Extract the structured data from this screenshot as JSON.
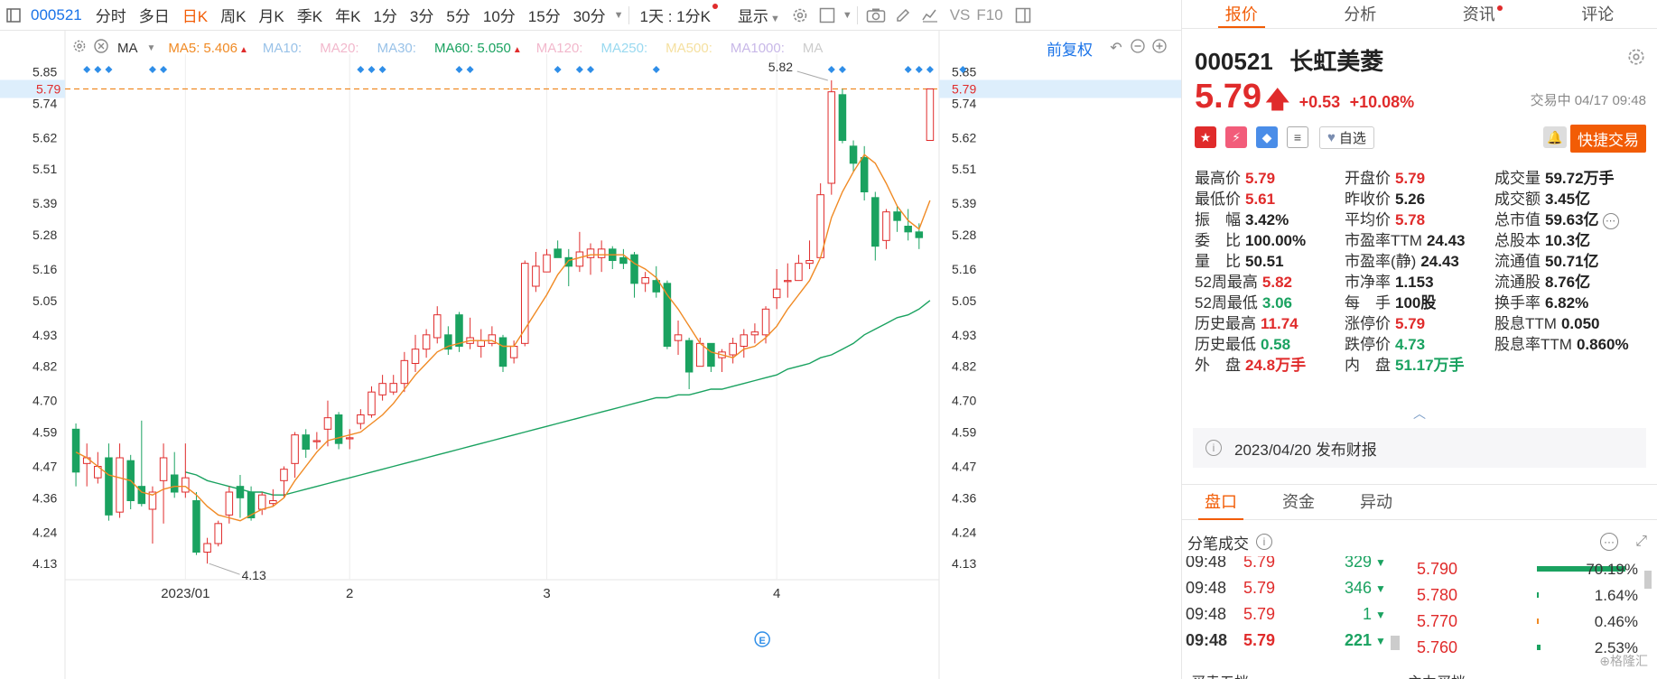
{
  "toolbar": {
    "code": "000521",
    "periods": [
      "分时",
      "多日",
      "日K",
      "周K",
      "月K",
      "季K",
      "年K",
      "1分",
      "3分",
      "5分",
      "10分",
      "15分",
      "30分"
    ],
    "active_period": "日K",
    "range_select": "1天 : 1分K",
    "display_label": "显示",
    "vs_label": "VS",
    "f10_label": "F10"
  },
  "ma_bar": {
    "type_label": "MA",
    "items": [
      {
        "label": "MA5:",
        "value": "5.406",
        "color": "#f08a24",
        "show_value": true
      },
      {
        "label": "MA10:",
        "value": "",
        "color": "#99c2e8",
        "show_value": false
      },
      {
        "label": "MA20:",
        "value": "",
        "color": "#f2b8cc",
        "show_value": false
      },
      {
        "label": "MA30:",
        "value": "",
        "color": "#99c2e8",
        "show_value": false
      },
      {
        "label": "MA60:",
        "value": "5.050",
        "color": "#1aa260",
        "show_value": true
      },
      {
        "label": "MA120:",
        "value": "",
        "color": "#f2b8cc",
        "show_value": false
      },
      {
        "label": "MA250:",
        "value": "",
        "color": "#99d9f0",
        "show_value": false
      },
      {
        "label": "MA500:",
        "value": "",
        "color": "#f5e0a0",
        "show_value": false
      },
      {
        "label": "MA1000:",
        "value": "",
        "color": "#c8b8e8",
        "show_value": false
      },
      {
        "label": "MA",
        "value": "",
        "color": "#cccccc",
        "show_value": false
      }
    ],
    "adjust_label": "前复权"
  },
  "chart_data": {
    "type": "candlestick",
    "price_axis_ticks": [
      "5.85",
      "5.74",
      "5.62",
      "5.51",
      "5.39",
      "5.28",
      "5.16",
      "5.05",
      "4.93",
      "4.82",
      "4.70",
      "4.59",
      "4.47",
      "4.36",
      "4.24",
      "4.13"
    ],
    "ylim": [
      4.08,
      5.88
    ],
    "current_price_label": "5.79",
    "current_price": 5.79,
    "x_ticks": [
      {
        "label": "2023/01",
        "index": 10
      },
      {
        "label": "2",
        "index": 25
      },
      {
        "label": "3",
        "index": 43
      },
      {
        "label": "4",
        "index": 64
      }
    ],
    "high_annotation": "5.82",
    "low_annotation": "4.13",
    "candles": [
      {
        "o": 4.6,
        "c": 4.45,
        "h": 4.62,
        "l": 4.4
      },
      {
        "o": 4.48,
        "c": 4.5,
        "h": 4.55,
        "l": 4.4
      },
      {
        "o": 4.43,
        "c": 4.47,
        "h": 4.52,
        "l": 4.41
      },
      {
        "o": 4.5,
        "c": 4.3,
        "h": 4.55,
        "l": 4.28
      },
      {
        "o": 4.31,
        "c": 4.5,
        "h": 4.55,
        "l": 4.29
      },
      {
        "o": 4.49,
        "c": 4.35,
        "h": 4.51,
        "l": 4.32
      },
      {
        "o": 4.4,
        "c": 4.34,
        "h": 4.63,
        "l": 4.33
      },
      {
        "o": 4.32,
        "c": 4.38,
        "h": 4.4,
        "l": 4.2
      },
      {
        "o": 4.42,
        "c": 4.5,
        "h": 4.55,
        "l": 4.27
      },
      {
        "o": 4.44,
        "c": 4.38,
        "h": 4.52,
        "l": 4.36
      },
      {
        "o": 4.38,
        "c": 4.43,
        "h": 4.55,
        "l": 4.36
      },
      {
        "o": 4.35,
        "c": 4.17,
        "h": 4.38,
        "l": 4.16
      },
      {
        "o": 4.17,
        "c": 4.2,
        "h": 4.22,
        "l": 4.13
      },
      {
        "o": 4.2,
        "c": 4.27,
        "h": 4.28,
        "l": 4.19
      },
      {
        "o": 4.3,
        "c": 4.38,
        "h": 4.4,
        "l": 4.27
      },
      {
        "o": 4.4,
        "c": 4.36,
        "h": 4.44,
        "l": 4.29
      },
      {
        "o": 4.38,
        "c": 4.29,
        "h": 4.4,
        "l": 4.28
      },
      {
        "o": 4.32,
        "c": 4.37,
        "h": 4.38,
        "l": 4.3
      },
      {
        "o": 4.34,
        "c": 4.35,
        "h": 4.39,
        "l": 4.33
      },
      {
        "o": 4.42,
        "c": 4.46,
        "h": 4.47,
        "l": 4.36
      },
      {
        "o": 4.48,
        "c": 4.58,
        "h": 4.59,
        "l": 4.43
      },
      {
        "o": 4.58,
        "c": 4.53,
        "h": 4.6,
        "l": 4.5
      },
      {
        "o": 4.56,
        "c": 4.56,
        "h": 4.59,
        "l": 4.53
      },
      {
        "o": 4.6,
        "c": 4.64,
        "h": 4.7,
        "l": 4.54
      },
      {
        "o": 4.65,
        "c": 4.55,
        "h": 4.66,
        "l": 4.53
      },
      {
        "o": 4.57,
        "c": 4.57,
        "h": 4.6,
        "l": 4.53
      },
      {
        "o": 4.62,
        "c": 4.65,
        "h": 4.67,
        "l": 4.6
      },
      {
        "o": 4.65,
        "c": 4.73,
        "h": 4.75,
        "l": 4.64
      },
      {
        "o": 4.72,
        "c": 4.76,
        "h": 4.79,
        "l": 4.7
      },
      {
        "o": 4.73,
        "c": 4.76,
        "h": 4.79,
        "l": 4.72
      },
      {
        "o": 4.76,
        "c": 4.84,
        "h": 4.87,
        "l": 4.73
      },
      {
        "o": 4.83,
        "c": 4.88,
        "h": 4.93,
        "l": 4.8
      },
      {
        "o": 4.88,
        "c": 4.93,
        "h": 4.95,
        "l": 4.85
      },
      {
        "o": 4.92,
        "c": 5.0,
        "h": 5.03,
        "l": 4.9
      },
      {
        "o": 4.93,
        "c": 4.88,
        "h": 4.96,
        "l": 4.86
      },
      {
        "o": 5.0,
        "c": 4.89,
        "h": 5.01,
        "l": 4.87
      },
      {
        "o": 4.9,
        "c": 4.92,
        "h": 4.99,
        "l": 4.88
      },
      {
        "o": 4.89,
        "c": 4.91,
        "h": 4.95,
        "l": 4.85
      },
      {
        "o": 4.9,
        "c": 4.93,
        "h": 4.96,
        "l": 4.89
      },
      {
        "o": 4.92,
        "c": 4.82,
        "h": 4.93,
        "l": 4.8
      },
      {
        "o": 4.85,
        "c": 4.89,
        "h": 4.91,
        "l": 4.83
      },
      {
        "o": 4.9,
        "c": 5.18,
        "h": 5.19,
        "l": 4.89
      },
      {
        "o": 5.1,
        "c": 5.17,
        "h": 5.22,
        "l": 5.08
      },
      {
        "o": 5.15,
        "c": 5.21,
        "h": 5.23,
        "l": 5.15
      },
      {
        "o": 5.23,
        "c": 5.2,
        "h": 5.26,
        "l": 5.2
      },
      {
        "o": 5.2,
        "c": 5.17,
        "h": 5.23,
        "l": 5.1
      },
      {
        "o": 5.17,
        "c": 5.22,
        "h": 5.29,
        "l": 5.15
      },
      {
        "o": 5.2,
        "c": 5.23,
        "h": 5.25,
        "l": 5.14
      },
      {
        "o": 5.2,
        "c": 5.23,
        "h": 5.26,
        "l": 5.15
      },
      {
        "o": 5.23,
        "c": 5.19,
        "h": 5.24,
        "l": 5.16
      },
      {
        "o": 5.2,
        "c": 5.18,
        "h": 5.23,
        "l": 5.16
      },
      {
        "o": 5.21,
        "c": 5.11,
        "h": 5.22,
        "l": 5.06
      },
      {
        "o": 5.11,
        "c": 5.13,
        "h": 5.15,
        "l": 5.08
      },
      {
        "o": 5.12,
        "c": 5.08,
        "h": 5.17,
        "l": 5.06
      },
      {
        "o": 5.11,
        "c": 4.89,
        "h": 5.12,
        "l": 4.88
      },
      {
        "o": 4.91,
        "c": 4.93,
        "h": 4.98,
        "l": 4.86
      },
      {
        "o": 4.91,
        "c": 4.8,
        "h": 4.92,
        "l": 4.74
      },
      {
        "o": 4.82,
        "c": 4.9,
        "h": 4.92,
        "l": 4.82
      },
      {
        "o": 4.9,
        "c": 4.82,
        "h": 4.9,
        "l": 4.8
      },
      {
        "o": 4.85,
        "c": 4.87,
        "h": 4.88,
        "l": 4.8
      },
      {
        "o": 4.86,
        "c": 4.9,
        "h": 4.92,
        "l": 4.83
      },
      {
        "o": 4.89,
        "c": 4.93,
        "h": 4.95,
        "l": 4.85
      },
      {
        "o": 4.93,
        "c": 4.94,
        "h": 4.97,
        "l": 4.9
      },
      {
        "o": 4.93,
        "c": 5.02,
        "h": 5.03,
        "l": 4.9
      },
      {
        "o": 5.06,
        "c": 5.09,
        "h": 5.16,
        "l": 5.02
      },
      {
        "o": 5.12,
        "c": 5.12,
        "h": 5.18,
        "l": 5.06
      },
      {
        "o": 5.12,
        "c": 5.18,
        "h": 5.21,
        "l": 5.12
      },
      {
        "o": 5.18,
        "c": 5.19,
        "h": 5.26,
        "l": 5.16
      },
      {
        "o": 5.2,
        "c": 5.42,
        "h": 5.46,
        "l": 5.2
      },
      {
        "o": 5.46,
        "c": 5.78,
        "h": 5.82,
        "l": 5.42
      },
      {
        "o": 5.77,
        "c": 5.61,
        "h": 5.79,
        "l": 5.6
      },
      {
        "o": 5.59,
        "c": 5.53,
        "h": 5.61,
        "l": 5.5
      },
      {
        "o": 5.55,
        "c": 5.43,
        "h": 5.59,
        "l": 5.4
      },
      {
        "o": 5.41,
        "c": 5.24,
        "h": 5.43,
        "l": 5.19
      },
      {
        "o": 5.26,
        "c": 5.36,
        "h": 5.37,
        "l": 5.23
      },
      {
        "o": 5.36,
        "c": 5.33,
        "h": 5.38,
        "l": 5.29
      },
      {
        "o": 5.31,
        "c": 5.29,
        "h": 5.37,
        "l": 5.26
      },
      {
        "o": 5.29,
        "c": 5.27,
        "h": 5.32,
        "l": 5.23
      },
      {
        "o": 5.61,
        "c": 5.79,
        "h": 5.79,
        "l": 5.61
      }
    ],
    "ma5": [
      4.52,
      4.5,
      4.47,
      4.44,
      4.43,
      4.42,
      4.38,
      4.37,
      4.39,
      4.4,
      4.4,
      4.37,
      4.33,
      4.3,
      4.29,
      4.28,
      4.3,
      4.32,
      4.33,
      4.36,
      4.42,
      4.47,
      4.52,
      4.56,
      4.57,
      4.58,
      4.59,
      4.62,
      4.65,
      4.69,
      4.74,
      4.79,
      4.83,
      4.87,
      4.89,
      4.9,
      4.91,
      4.91,
      4.91,
      4.89,
      4.89,
      4.95,
      5.01,
      5.07,
      5.14,
      5.19,
      5.2,
      5.21,
      5.21,
      5.21,
      5.21,
      5.18,
      5.16,
      5.13,
      5.07,
      5.02,
      4.96,
      4.9,
      4.87,
      4.86,
      4.85,
      4.88,
      4.89,
      4.92,
      4.96,
      5.02,
      5.07,
      5.12,
      5.2,
      5.34,
      5.43,
      5.5,
      5.56,
      5.53,
      5.46,
      5.38,
      5.33,
      5.3,
      5.4
    ],
    "ma60_start": 10,
    "ma60": [
      4.45,
      4.44,
      4.42,
      4.41,
      4.4,
      4.39,
      4.38,
      4.38,
      4.37,
      4.37,
      4.38,
      4.39,
      4.4,
      4.41,
      4.42,
      4.43,
      4.44,
      4.45,
      4.46,
      4.47,
      4.48,
      4.49,
      4.5,
      4.51,
      4.52,
      4.53,
      4.54,
      4.55,
      4.56,
      4.57,
      4.58,
      4.59,
      4.6,
      4.61,
      4.62,
      4.63,
      4.64,
      4.65,
      4.66,
      4.67,
      4.68,
      4.69,
      4.7,
      4.71,
      4.71,
      4.72,
      4.72,
      4.73,
      4.74,
      4.74,
      4.75,
      4.76,
      4.77,
      4.78,
      4.79,
      4.81,
      4.82,
      4.83,
      4.85,
      4.86,
      4.88,
      4.9,
      4.93,
      4.95,
      4.97,
      4.99,
      5.0,
      5.02,
      5.05
    ],
    "signal_markers": [
      1,
      2,
      3,
      7,
      8,
      26,
      27,
      28,
      35,
      36,
      44,
      46,
      47,
      53,
      69,
      70,
      76,
      77,
      78,
      81
    ]
  },
  "quote": {
    "tabs": [
      "报价",
      "分析",
      "资讯",
      "评论"
    ],
    "code": "000521",
    "name": "长虹美菱",
    "price": "5.79",
    "arrow": "🡅",
    "change": "+0.53",
    "change_pct": "+10.08%",
    "status": "交易中 04/17 09:48",
    "watch_label": "自选",
    "quick_trade": "快捷交易",
    "stats": [
      [
        {
          "l": "最高价",
          "v": "5.79",
          "c": "red"
        },
        {
          "l": "开盘价",
          "v": "5.79",
          "c": "red"
        },
        {
          "l": "成交量",
          "v": "59.72万手",
          "c": "dark"
        }
      ],
      [
        {
          "l": "最低价",
          "v": "5.61",
          "c": "red"
        },
        {
          "l": "昨收价",
          "v": "5.26",
          "c": "dark"
        },
        {
          "l": "成交额",
          "v": "3.45亿",
          "c": "dark"
        }
      ],
      [
        {
          "l": "振　幅",
          "v": "3.42%",
          "c": "dark"
        },
        {
          "l": "平均价",
          "v": "5.78",
          "c": "red"
        },
        {
          "l": "总市值",
          "v": "59.63亿",
          "c": "dark"
        }
      ],
      [
        {
          "l": "委　比",
          "v": "100.00%",
          "c": "dark"
        },
        {
          "l": "市盈率TTM",
          "v": "24.43",
          "c": "dark"
        },
        {
          "l": "总股本",
          "v": "10.3亿",
          "c": "dark"
        }
      ],
      [
        {
          "l": "量　比",
          "v": "50.51",
          "c": "dark"
        },
        {
          "l": "市盈率(静)",
          "v": "24.43",
          "c": "dark"
        },
        {
          "l": "流通值",
          "v": "50.71亿",
          "c": "dark"
        }
      ],
      [
        {
          "l": "52周最高",
          "v": "5.82",
          "c": "red"
        },
        {
          "l": "市净率",
          "v": "1.153",
          "c": "dark"
        },
        {
          "l": "流通股",
          "v": "8.76亿",
          "c": "dark"
        }
      ],
      [
        {
          "l": "52周最低",
          "v": "3.06",
          "c": "green"
        },
        {
          "l": "每　手",
          "v": "100股",
          "c": "dark"
        },
        {
          "l": "换手率",
          "v": "6.82%",
          "c": "dark"
        }
      ],
      [
        {
          "l": "历史最高",
          "v": "11.74",
          "c": "red"
        },
        {
          "l": "涨停价",
          "v": "5.79",
          "c": "red"
        },
        {
          "l": "股息TTM",
          "v": "0.050",
          "c": "dark"
        }
      ],
      [
        {
          "l": "历史最低",
          "v": "0.58",
          "c": "green"
        },
        {
          "l": "跌停价",
          "v": "4.73",
          "c": "green"
        },
        {
          "l": "股息率TTM",
          "v": "0.860%",
          "c": "dark"
        }
      ],
      [
        {
          "l": "外　盘",
          "v": "24.8万手",
          "c": "red"
        },
        {
          "l": "内　盘",
          "v": "51.17万手",
          "c": "green"
        }
      ]
    ],
    "report_text": "2023/04/20  发布财报"
  },
  "orderbook": {
    "tabs": [
      "盘口",
      "资金",
      "异动"
    ],
    "tick_title": "分笔成交",
    "ticks": [
      {
        "t": "09:48",
        "p": "5.79",
        "v": "329",
        "bold": false
      },
      {
        "t": "09:48",
        "p": "5.79",
        "v": "346",
        "bold": false
      },
      {
        "t": "09:48",
        "p": "5.79",
        "v": "1",
        "bold": false
      },
      {
        "t": "09:48",
        "p": "5.79",
        "v": "221",
        "bold": true
      }
    ],
    "depth": [
      {
        "p": "5.790",
        "pct": "70.19%",
        "w": 0.7019
      },
      {
        "p": "5.780",
        "pct": "1.64%",
        "w": 0.0164
      },
      {
        "p": "5.770",
        "pct": "0.46%",
        "w": 0.0046
      },
      {
        "p": "5.760",
        "pct": "2.53%",
        "w": 0.0253
      }
    ],
    "bottom_left": "买卖五档",
    "bottom_right": "主力买档"
  }
}
